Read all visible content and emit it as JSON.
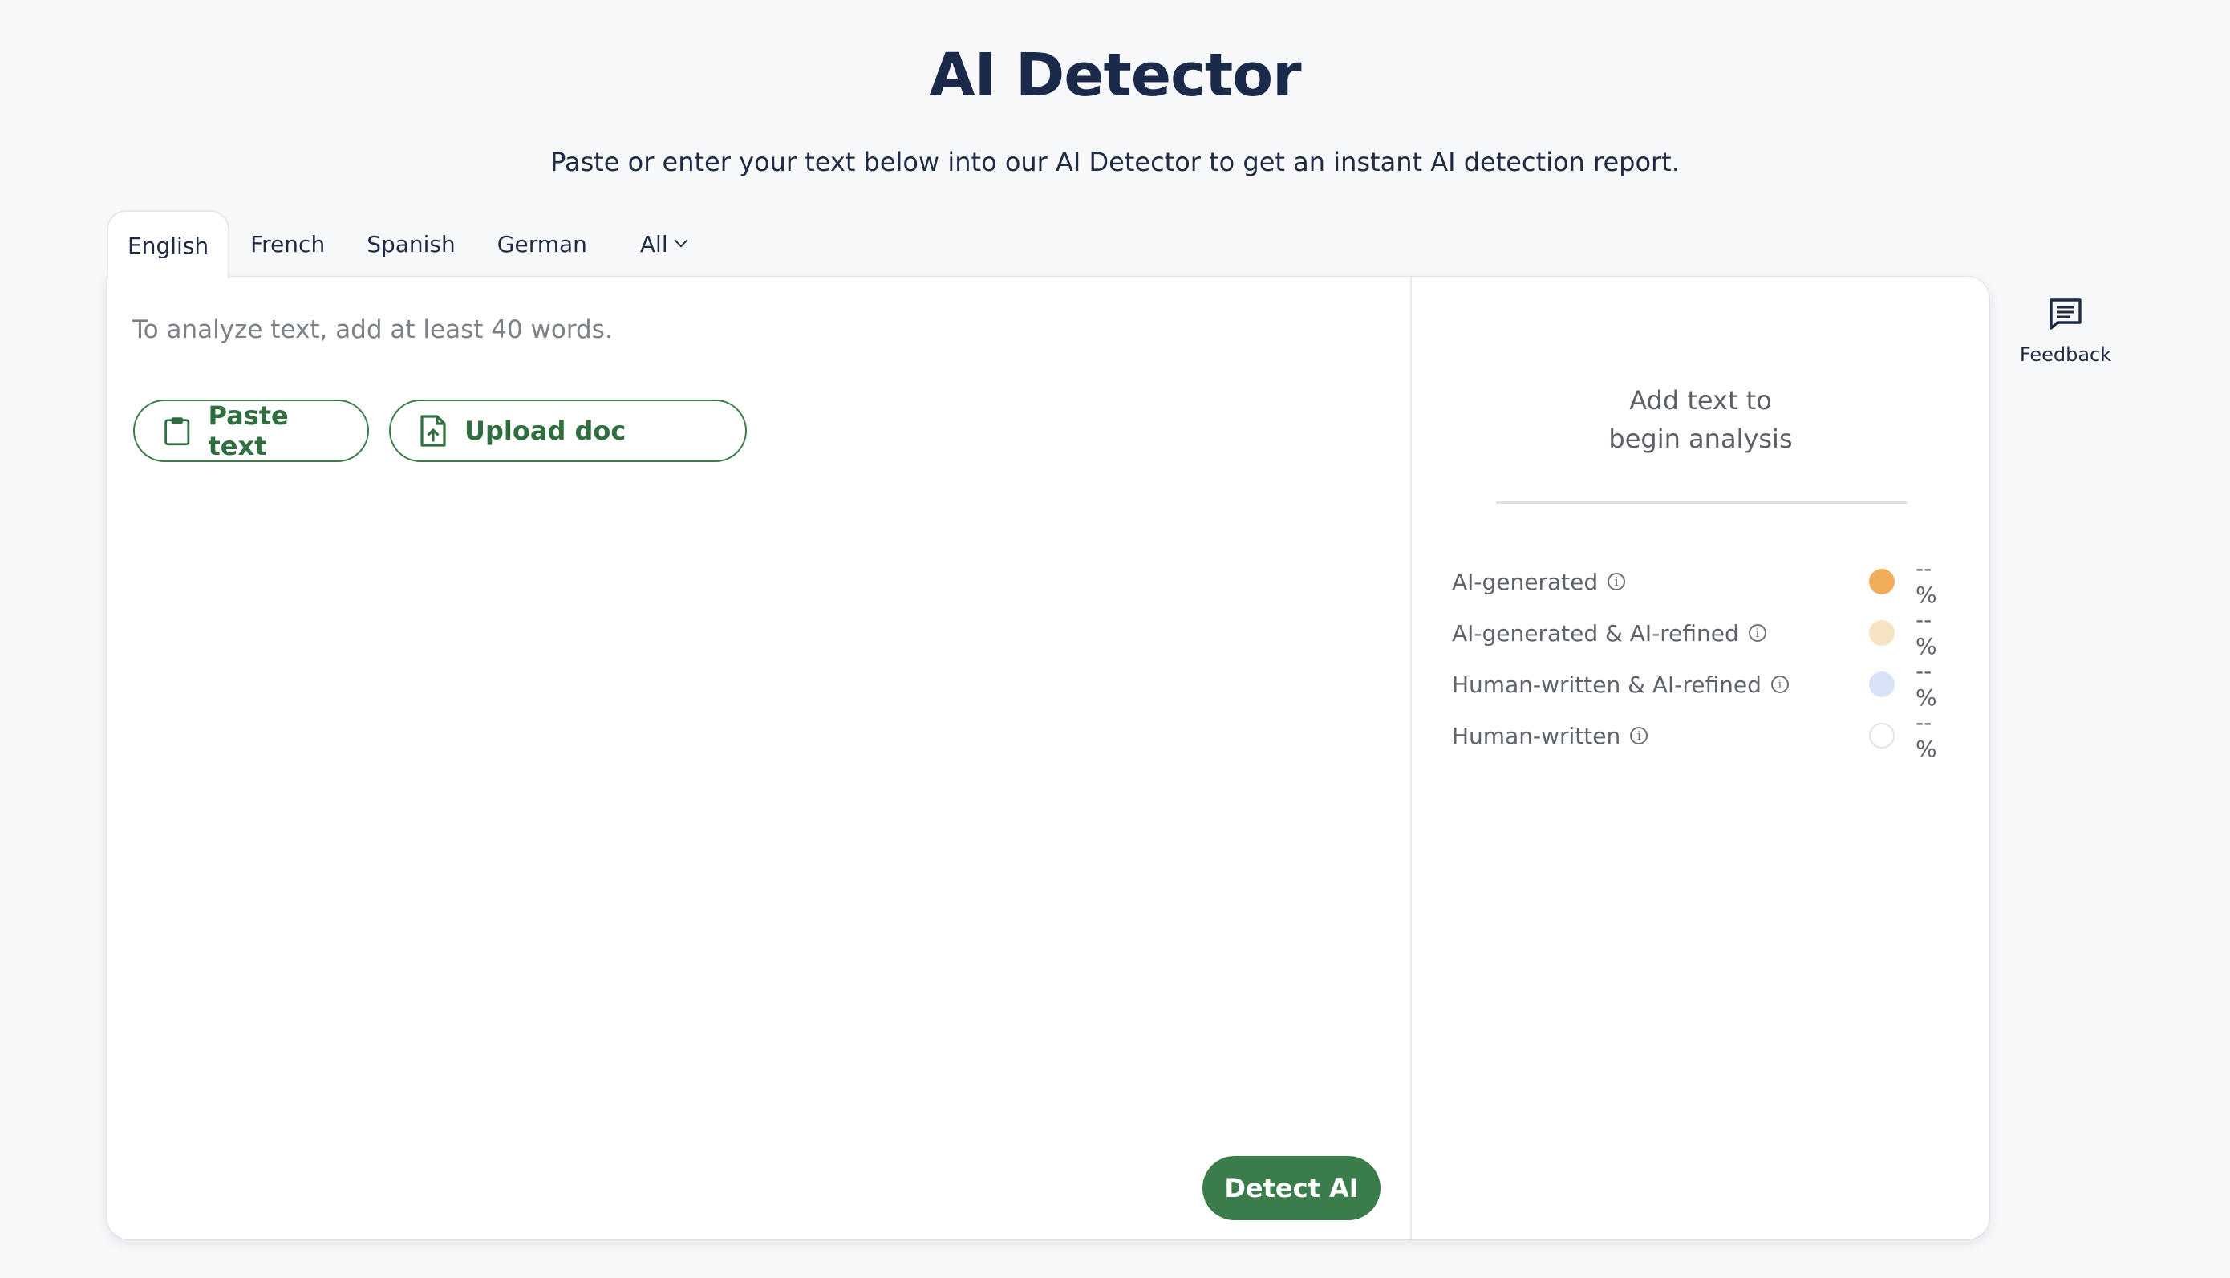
{
  "header": {
    "title": "AI Detector",
    "subtitle": "Paste or enter your text below into our AI Detector to get an instant AI detection report."
  },
  "tabs": [
    {
      "label": "English",
      "active": true
    },
    {
      "label": "French",
      "active": false
    },
    {
      "label": "Spanish",
      "active": false
    },
    {
      "label": "German",
      "active": false
    },
    {
      "label": "All",
      "active": false,
      "dropdown": true
    }
  ],
  "editor": {
    "placeholder": "To analyze text, add at least 40 words.",
    "paste_label": "Paste text",
    "upload_label": "Upload doc",
    "detect_label": "Detect AI"
  },
  "results": {
    "message_line1": "Add text to",
    "message_line2": "begin analysis",
    "legend": [
      {
        "label": "AI-generated",
        "value": "--%",
        "color": "#f0ae5a"
      },
      {
        "label": "AI-generated & AI-refined",
        "value": "--%",
        "color": "#f6e3c4"
      },
      {
        "label": "Human-written & AI-refined",
        "value": "--%",
        "color": "#d9e3f8"
      },
      {
        "label": "Human-written",
        "value": "--%",
        "color": "#ffffff"
      }
    ]
  },
  "feedback": {
    "label": "Feedback",
    "icon": "message-icon"
  },
  "colors": {
    "accent": "#3a7d4a",
    "background": "#f7f8fa"
  }
}
